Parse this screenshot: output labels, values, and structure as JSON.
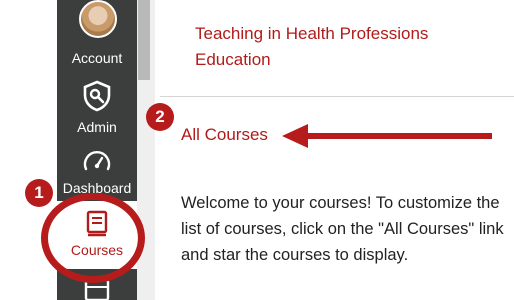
{
  "nav": {
    "account_label": "Account",
    "admin_label": "Admin",
    "dashboard_label": "Dashboard",
    "courses_label": "Courses",
    "icons": [
      "avatar",
      "admin-shield-icon",
      "dashboard-gauge-icon",
      "courses-book-icon",
      "calendar-icon"
    ]
  },
  "callouts": {
    "step1": "1",
    "step2": "2"
  },
  "main": {
    "course_title": "Teaching in Health Professions Education",
    "all_courses_link": "All Courses",
    "welcome_text": "Welcome to your courses! To customize the list of courses, click on the \"All Courses\" link and star the courses to display."
  },
  "colors": {
    "nav_bg": "#3c3d3d",
    "accent_red": "#b11b1b",
    "callout_red": "#b71c1c"
  }
}
